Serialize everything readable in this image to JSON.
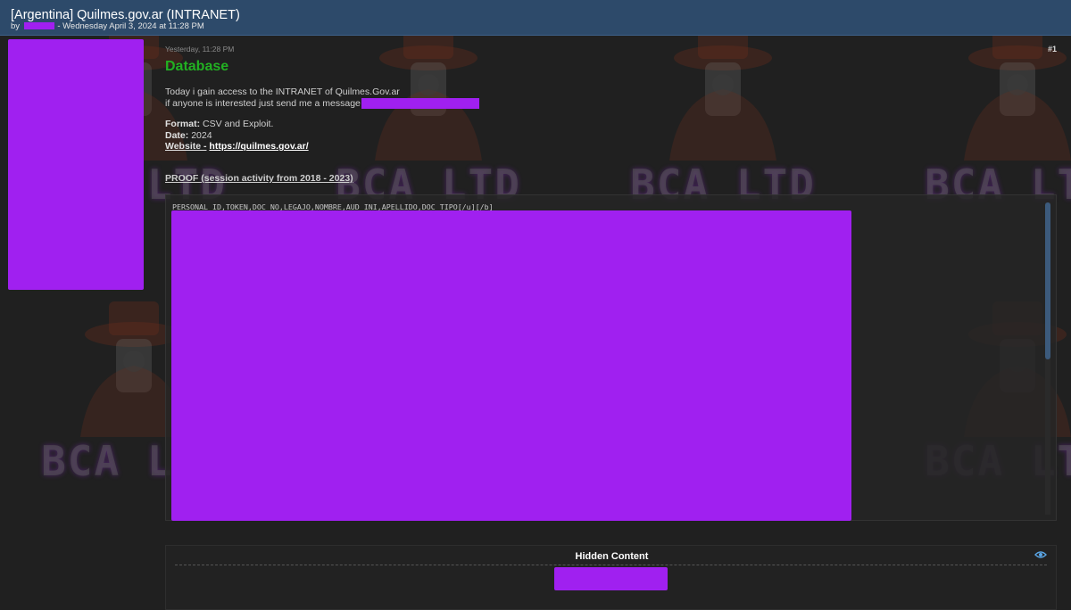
{
  "thread": {
    "title": "[Argentina] Quilmes.gov.ar (INTRANET)",
    "by_label": "by",
    "date_text": "- Wednesday April 3, 2024 at 11:28 PM"
  },
  "post": {
    "time": "Yesterday, 11:28 PM",
    "number": "#1",
    "heading": "Database",
    "intro_line1": "Today i gain access to the INTRANET of Quilmes.Gov.ar",
    "intro_line2": "if anyone is interested just send me a message",
    "format_label": "Format:",
    "format_value": "CSV and Exploit.",
    "date_label": "Date:",
    "date_value": "2024",
    "website_label": "Website -",
    "website_url": "https://quilmes.gov.ar/",
    "proof_text": "PROOF (session activity from 2018 - 2023)"
  },
  "code": {
    "first_line": "PERSONAL_ID,TOKEN,DOC_NO,LEGAJO,NOMBRE,AUD_INI,APELLIDO,DOC_TIPO[/u][/b]"
  },
  "hidden": {
    "title": "Hidden Content"
  },
  "watermark": {
    "text": "BCA LTD"
  },
  "colors": {
    "title_bar": "#2d4a6a",
    "heading_green": "#22b022",
    "redaction": "#a020f0",
    "background": "#202020"
  },
  "icons": {
    "visibility": "eye-icon"
  }
}
